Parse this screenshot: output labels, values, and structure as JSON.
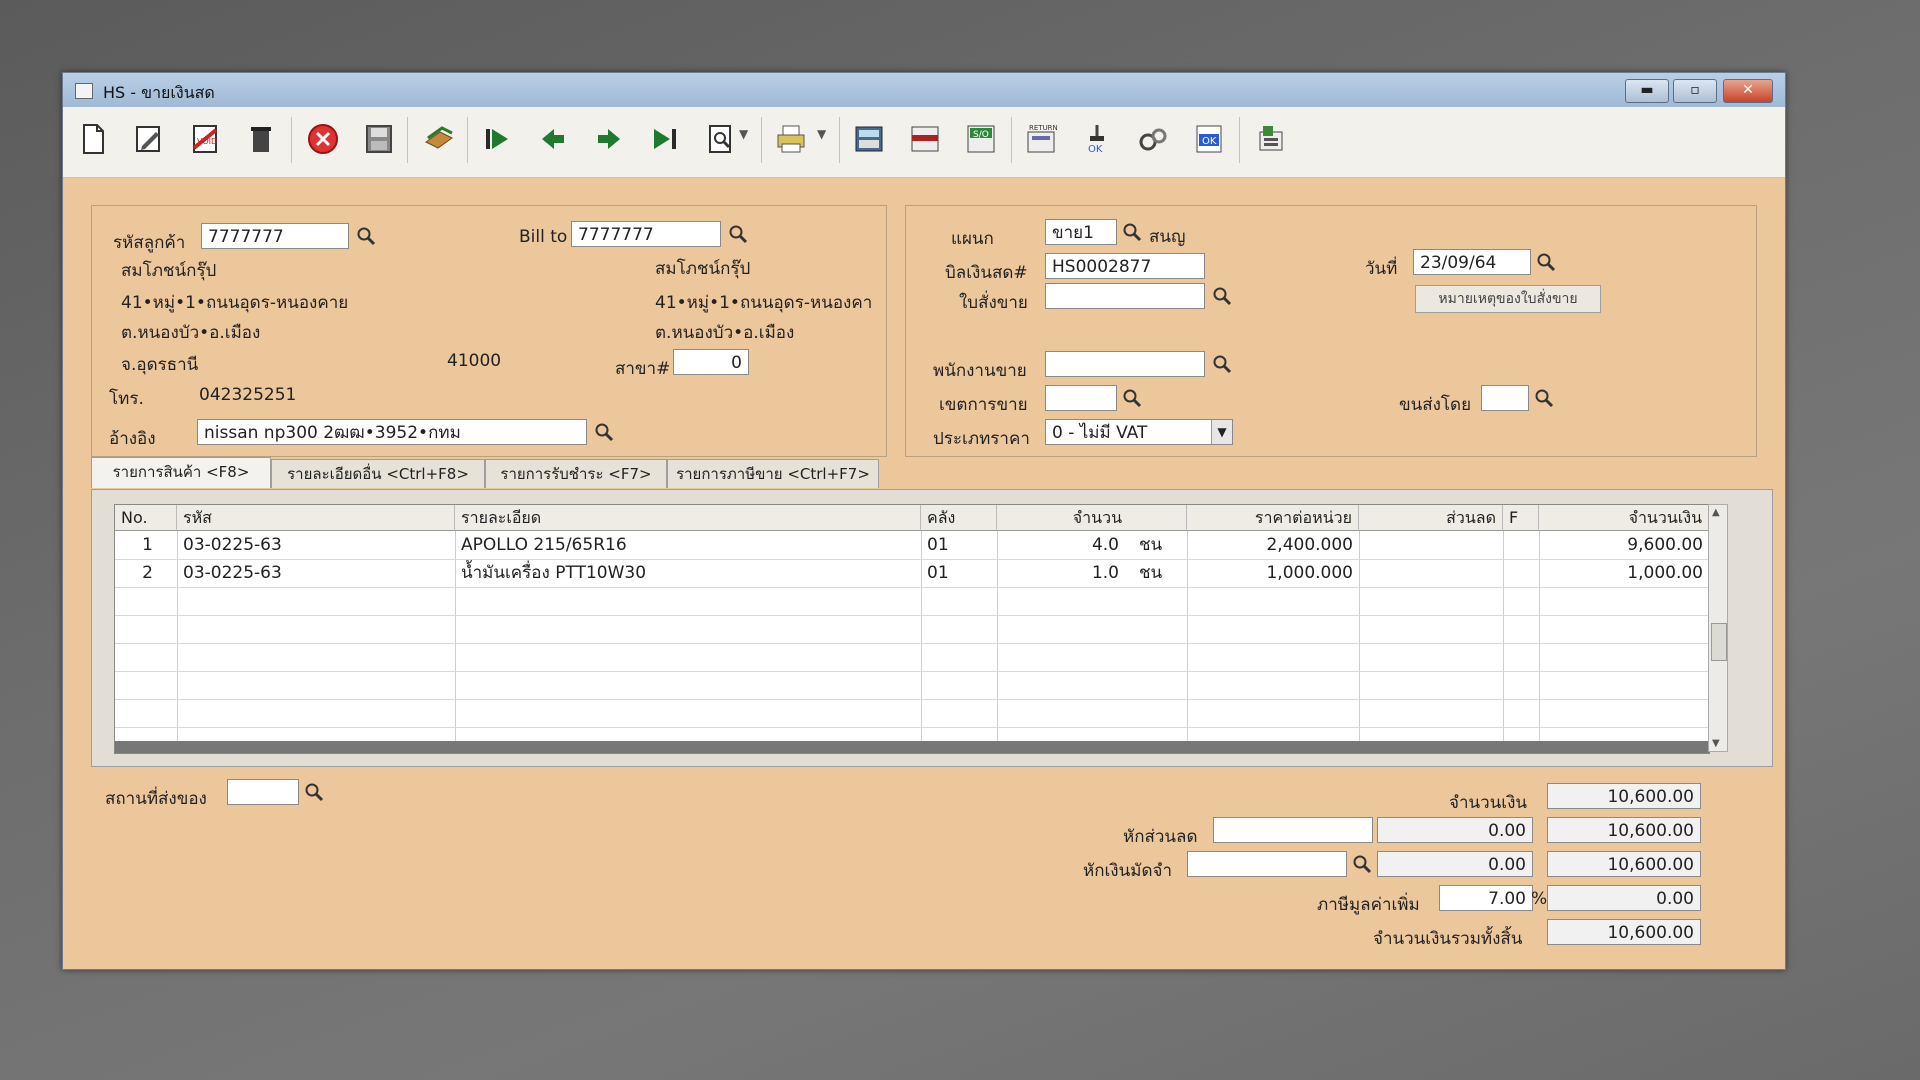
{
  "window": {
    "title": "HS - ขายเงินสด",
    "buttons": {
      "minimize": "▬",
      "maximize": "▫",
      "close": "✕"
    }
  },
  "toolbar": {
    "icons": [
      "new-doc-icon",
      "edit-icon",
      "void-icon",
      "delete-bin-icon",
      "cancel-icon",
      "save-icon",
      "copy-icon",
      "first-record-icon",
      "previous-record-icon",
      "next-record-icon",
      "last-record-icon",
      "search-doc-icon",
      "print-icon",
      "calculator-icon",
      "form-icon",
      "so-icon",
      "return-icon",
      "approve-icon",
      "tools-icon",
      "ok-icon",
      "report-icon"
    ]
  },
  "customer": {
    "code_label": "รหัสลูกค้า",
    "code": "7777777",
    "name": "สมโภชน์กรุ๊ป",
    "addr1": "41•หมู่•1•ถนนอุดร-หนองคาย",
    "addr2": "ต.หนองบัว•อ.เมือง",
    "addr3": "จ.อุดรธานี",
    "postcode": "41000",
    "phone_label": "โทร.",
    "phone": "042325251",
    "ref_label": "อ้างอิง",
    "ref": "nissan np300 2ฒฒ•3952•กทม"
  },
  "bill_to": {
    "label": "Bill to",
    "code": "7777777",
    "name": "สมโภชน์กรุ๊ป",
    "addr1": "41•หมู่•1•ถนนอุดร-หนองคา",
    "addr2": "ต.หนองบัว•อ.เมือง",
    "branch_label": "สาขา#",
    "branch": "0"
  },
  "doc": {
    "dept_label": "แผนก",
    "dept": "ขาย1",
    "dept_name": "สนญ",
    "cash_bill_label": "บิลเงินสด#",
    "cash_bill": "HS0002877",
    "date_label": "วันที่",
    "date": "23/09/64",
    "so_label": "ใบสั่งขาย",
    "so": "",
    "so_note_button": "หมายเหตุของใบสั่งขาย",
    "salesman_label": "พนักงานขาย",
    "salesman": "",
    "area_label": "เขตการขาย",
    "area": "",
    "ship_by_label": "ขนส่งโดย",
    "ship_by": "",
    "price_type_label": "ประเภทราคา",
    "price_type": "0 - ไม่มี VAT"
  },
  "tabs": [
    {
      "label": "รายการสินค้า <F8>"
    },
    {
      "label": "รายละเอียดอื่น <Ctrl+F8>"
    },
    {
      "label": "รายการรับชำระ <F7>"
    },
    {
      "label": "รายการภาษีขาย <Ctrl+F7>"
    }
  ],
  "table": {
    "columns": [
      "No.",
      "รหัส",
      "รายละเอียด",
      "คลัง",
      "จำนวน",
      "ราคาต่อหน่วย",
      "ส่วนลด",
      "F",
      "จำนวนเงิน"
    ],
    "rows": [
      {
        "no": "1",
        "code": "03-0225-63",
        "desc": "APOLLO 215/65R16",
        "wh": "01",
        "qty": "4.0",
        "unit": "ชน",
        "price": "2,400.000",
        "disc": "",
        "f": "",
        "amount": "9,600.00"
      },
      {
        "no": "2",
        "code": "03-0225-63",
        "desc": "น้ำมันเครื่อง PTT10W30",
        "wh": "01",
        "qty": "1.0",
        "unit": "ชน",
        "price": "1,000.000",
        "disc": "",
        "f": "",
        "amount": "1,000.00"
      }
    ]
  },
  "footer": {
    "ship_place_label": "สถานที่ส่งของ",
    "ship_place": "",
    "amount_label": "จำนวนเงิน",
    "amount": "10,600.00",
    "discount_label": "หักส่วนลด",
    "discount_input": "",
    "discount_value": "0.00",
    "after_discount": "10,600.00",
    "deposit_label": "หักเงินมัดจำ",
    "deposit_input": "",
    "deposit_value": "0.00",
    "after_deposit": "10,600.00",
    "vat_label": "ภาษีมูลค่าเพิ่ม",
    "vat_rate": "7.00",
    "vat_pct": "%",
    "vat_amount": "0.00",
    "total_label": "จำนวนเงินรวมทั้งสิ้น",
    "total": "10,600.00"
  }
}
